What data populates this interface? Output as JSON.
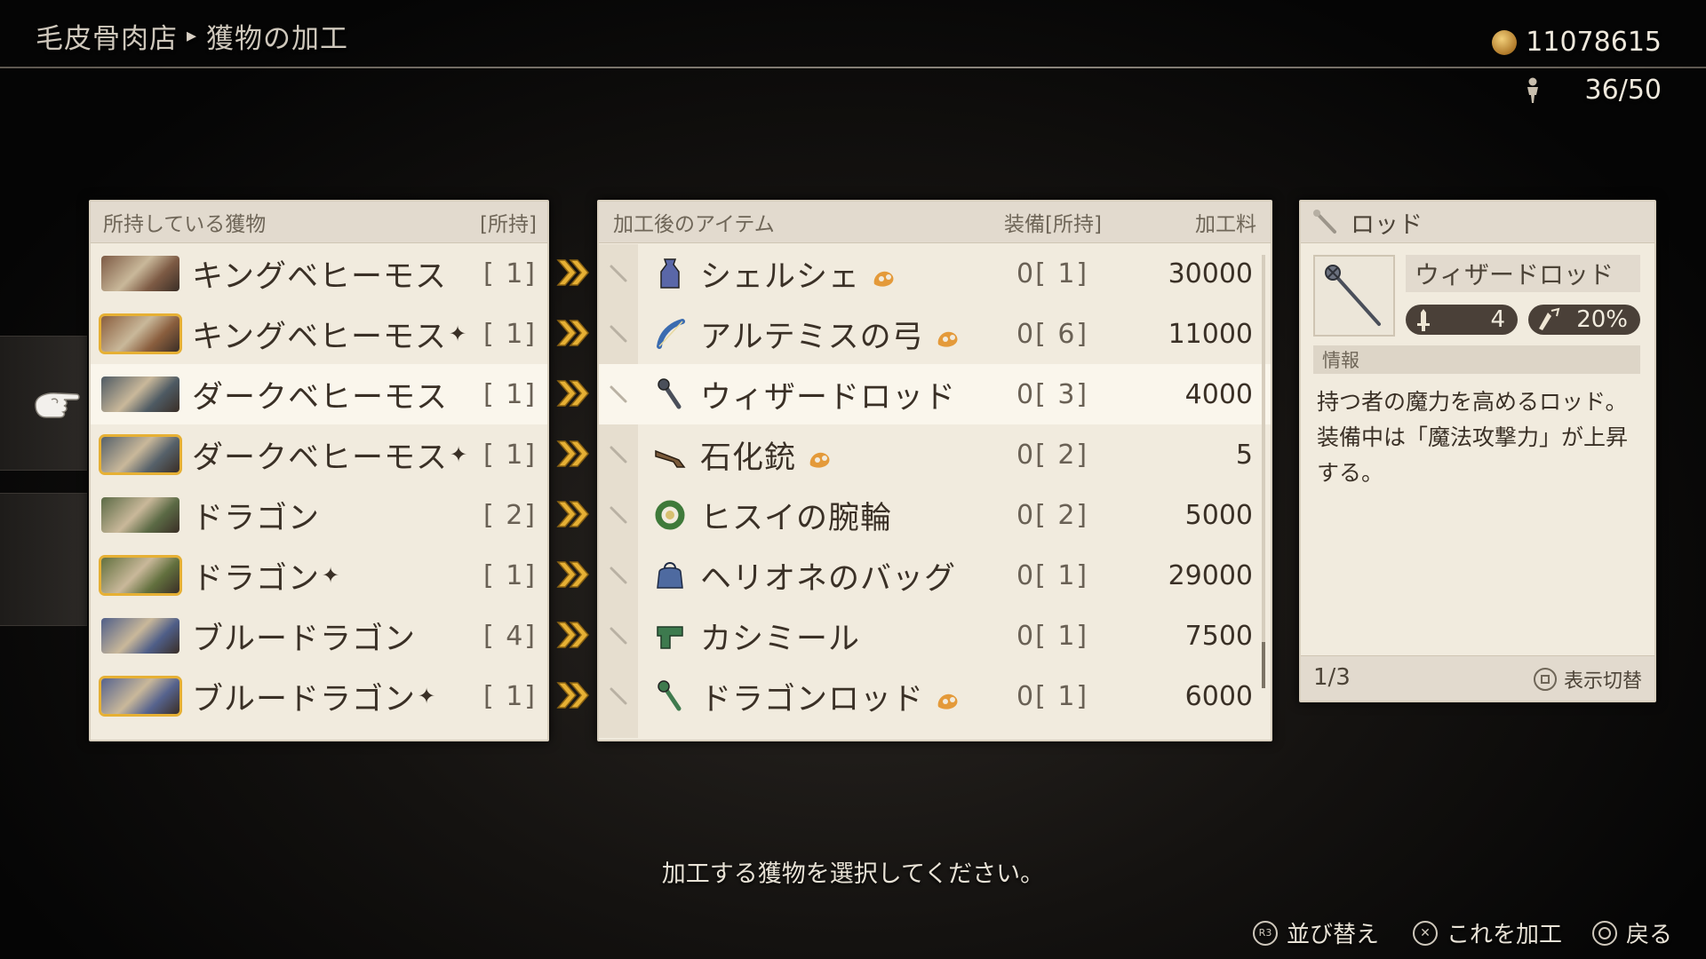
{
  "header": {
    "breadcrumb_shop": "毛皮骨肉店",
    "breadcrumb_sep": "▸",
    "breadcrumb_page": "獲物の加工",
    "gil": "11078615",
    "party_count": "36/50"
  },
  "left_panel": {
    "title": "所持している獲物",
    "col_owned": "[所持]",
    "items": [
      {
        "name": "キングベヒーモス",
        "rare": false,
        "qty": "[ 1]",
        "palette": "#7d5a44"
      },
      {
        "name": "キングベヒーモス",
        "rare": true,
        "qty": "[ 1]",
        "palette": "#8a5e3e"
      },
      {
        "name": "ダークベヒーモス",
        "rare": false,
        "qty": "[ 1]",
        "palette": "#4e5a63"
      },
      {
        "name": "ダークベヒーモス",
        "rare": true,
        "qty": "[ 1]",
        "palette": "#56616a"
      },
      {
        "name": "ドラゴン",
        "rare": false,
        "qty": "[ 2]",
        "palette": "#5b6a45"
      },
      {
        "name": "ドラゴン",
        "rare": true,
        "qty": "[ 1]",
        "palette": "#62703e"
      },
      {
        "name": "ブルードラゴン",
        "rare": false,
        "qty": "[ 4]",
        "palette": "#4f5e88"
      },
      {
        "name": "ブルードラゴン",
        "rare": true,
        "qty": "[ 1]",
        "palette": "#56638e"
      }
    ],
    "rare_mark": "✦",
    "selected_index": 2
  },
  "center_panel": {
    "title": "加工後のアイテム",
    "col_equip": "装備[所持]",
    "col_fee": "加工料",
    "items": [
      {
        "name": "シェルシェ",
        "marked": true,
        "equip": "0[ 1]",
        "fee": "30000",
        "icon": "accessory-icon",
        "icon_color": "#5a67a8"
      },
      {
        "name": "アルテミスの弓",
        "marked": true,
        "equip": "0[ 6]",
        "fee": "11000",
        "icon": "bow-icon",
        "icon_color": "#3b6cb0"
      },
      {
        "name": "ウィザードロッド",
        "marked": false,
        "equip": "0[ 3]",
        "fee": "4000",
        "icon": "rod-icon",
        "icon_color": "#4a4f5a"
      },
      {
        "name": "石化銃",
        "marked": true,
        "equip": "0[ 2]",
        "fee": "5",
        "icon": "gun-icon",
        "icon_color": "#7a5a3a"
      },
      {
        "name": "ヒスイの腕輪",
        "marked": false,
        "equip": "0[ 2]",
        "fee": "5000",
        "icon": "bracelet-icon",
        "icon_color": "#3f7a3a"
      },
      {
        "name": "ヘリオネのバッグ",
        "marked": false,
        "equip": "0[ 1]",
        "fee": "29000",
        "icon": "bag-icon",
        "icon_color": "#4e6aa0"
      },
      {
        "name": "カシミール",
        "marked": false,
        "equip": "0[ 1]",
        "fee": "7500",
        "icon": "scarf-icon",
        "icon_color": "#3d7a4e"
      },
      {
        "name": "ドラゴンロッド",
        "marked": true,
        "equip": "0[ 1]",
        "fee": "6000",
        "icon": "rod-icon",
        "icon_color": "#3f7a4e"
      }
    ]
  },
  "right_panel": {
    "category": "ロッド",
    "item_name": "ウィザードロッド",
    "attack": "4",
    "crit": "20%",
    "info_label": "情報",
    "description_lines": [
      "持つ者の魔力を高めるロッド。",
      "装備中は「魔法攻撃力」が上昇",
      "する。"
    ],
    "page": "1/3",
    "toggle_label": "表示切替"
  },
  "hint": "加工する獲物を選択してください。",
  "buttons": {
    "sort_label": "並び替え",
    "sort_key": "R3",
    "process_label": "これを加工",
    "back_label": "戻る"
  },
  "colors": {
    "accent_gold": "#e6b034",
    "panel_bg": "#f1ebde",
    "text_dark": "#3a3026"
  }
}
